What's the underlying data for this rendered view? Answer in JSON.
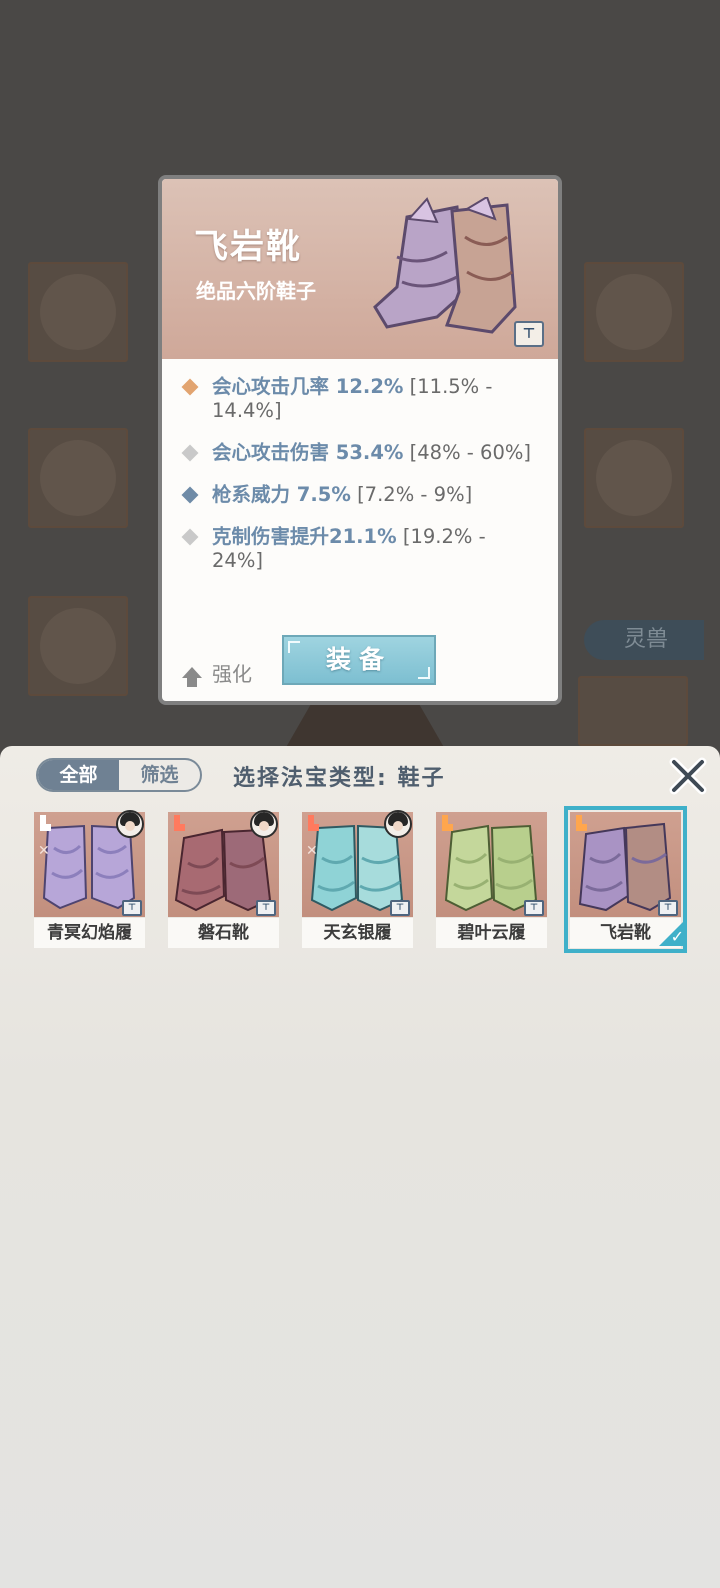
{
  "background": {
    "side_tag_label": "灵兽"
  },
  "item_detail": {
    "name": "飞岩靴",
    "subtitle": "绝品六阶鞋子",
    "stats": [
      {
        "main": "会心攻击几率 12.2%",
        "range": "[11.5% - 14.4%]",
        "diamond_color": "#e2a470"
      },
      {
        "main": "会心攻击伤害 53.4%",
        "range": "[48% - 60%]",
        "diamond_color": "#c9c9c9"
      },
      {
        "main": "枪系威力 7.5%",
        "range": "[7.2% - 9%]",
        "diamond_color": "#6f8ba7"
      },
      {
        "main": "克制伤害提升21.1%",
        "range": "[19.2% - 24%]",
        "diamond_color": "#c9c9c9"
      }
    ],
    "enhance_label": "强化",
    "equip_label": "装备"
  },
  "selector": {
    "toggle": {
      "all_label": "全部",
      "filter_label": "筛选"
    },
    "title": "选择法宝类型: 鞋子",
    "items": [
      {
        "name": "青冥幻焰履",
        "boot_tag_color": "#ffffff",
        "has_avatar": true,
        "palette": [
          "#b7a6d8",
          "#8c7fbc"
        ],
        "bg": "#c9988a"
      },
      {
        "name": "磐石靴",
        "boot_tag_color": "#ff7a5e",
        "has_avatar": true,
        "palette": [
          "#a86a72",
          "#7e4a55"
        ],
        "bg": "#c9988a"
      },
      {
        "name": "天玄银履",
        "boot_tag_color": "#ff7a5e",
        "has_avatar": true,
        "palette": [
          "#8fd3d6",
          "#5fa9b0"
        ],
        "bg": "#c9988a"
      },
      {
        "name": "碧叶云履",
        "boot_tag_color": "#ffa64d",
        "has_avatar": false,
        "palette": [
          "#c4d79b",
          "#98b172"
        ],
        "bg": "#c9988a"
      },
      {
        "name": "飞岩靴",
        "boot_tag_color": "#ffa64d",
        "has_avatar": false,
        "palette": [
          "#a993c4",
          "#7b6a9a"
        ],
        "bg": "#c9988a",
        "selected": true
      }
    ]
  },
  "colors": {
    "accent_blue": "#6c8baa",
    "selected_outline": "#3fb0c9",
    "equip_button": "#8fcbd9"
  }
}
